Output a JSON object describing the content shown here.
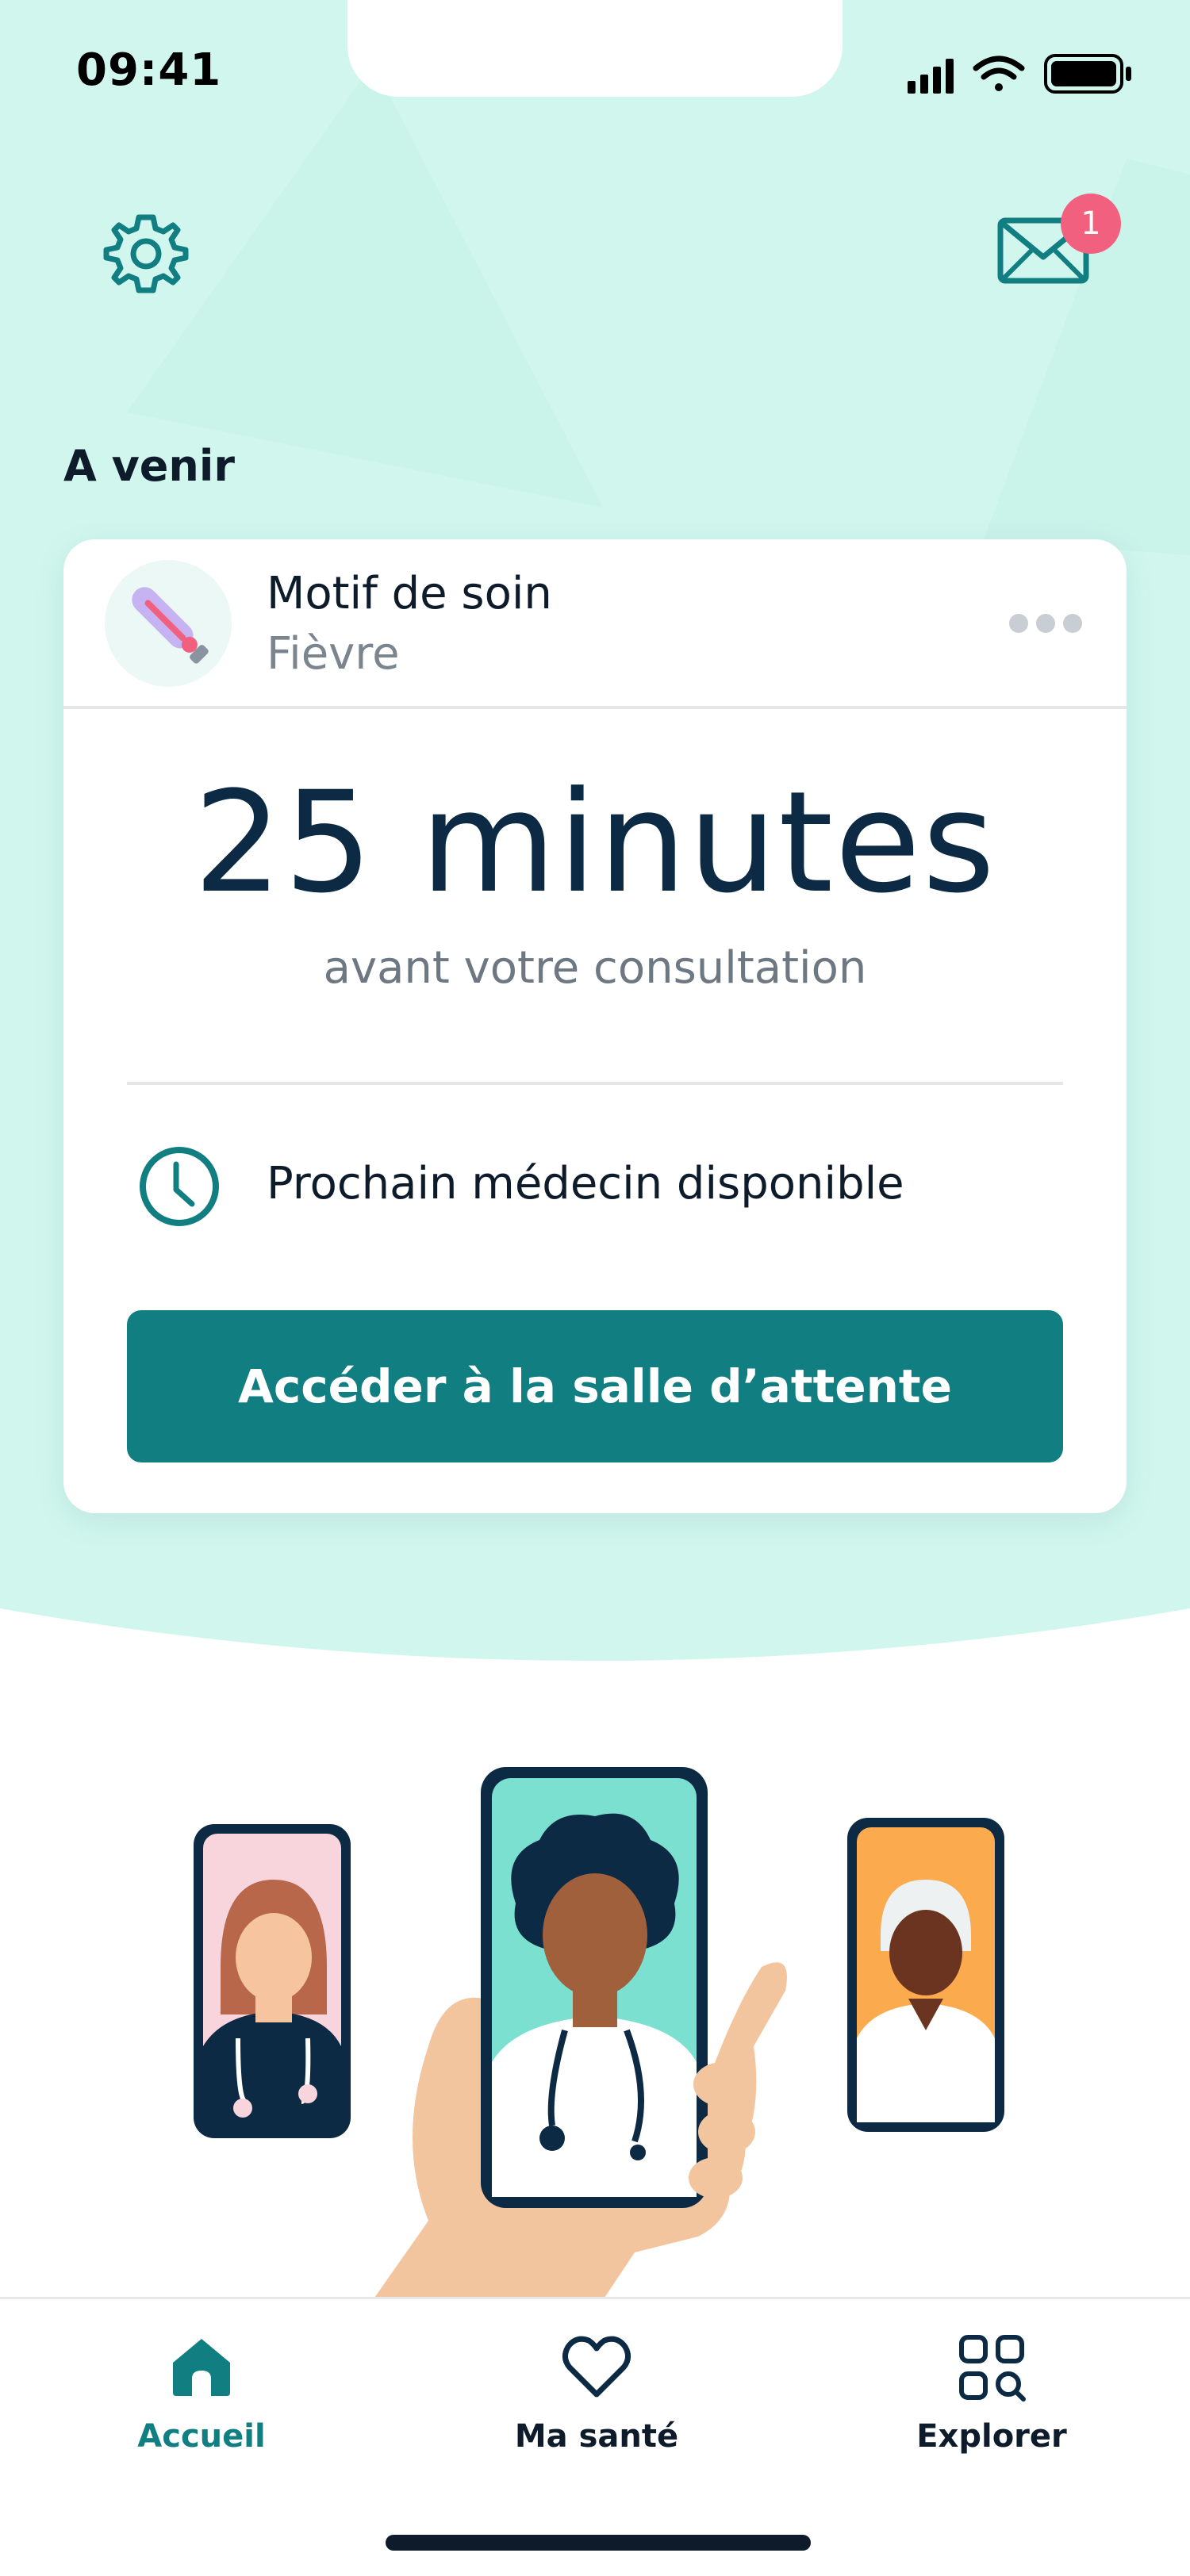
{
  "status_bar": {
    "time": "09:41",
    "icons": [
      "signal-icon",
      "wifi-icon",
      "battery-icon"
    ]
  },
  "header": {
    "settings_icon": "gear-icon",
    "mail_icon": "envelope-icon",
    "mail_badge_count": "1"
  },
  "section": {
    "title": "A venir"
  },
  "appointment_card": {
    "motif_label": "Motif de soin",
    "motif_value": "Fièvre",
    "motif_icon": "thermometer-icon",
    "more_icon": "more-dots-icon",
    "countdown": "25 minutes",
    "countdown_sub": "avant votre consultation",
    "doctor_icon": "clock-icon",
    "doctor_text": "Prochain médecin disponible",
    "cta_label": "Accéder à la salle d’attente"
  },
  "bottom_nav": {
    "items": [
      {
        "label": "Accueil",
        "icon": "home-icon",
        "active": true
      },
      {
        "label": "Ma santé",
        "icon": "heart-icon",
        "active": false
      },
      {
        "label": "Explorer",
        "icon": "grid-search-icon",
        "active": false
      }
    ]
  },
  "colors": {
    "mint_bg": "#d1f6ee",
    "primary": "#117e82",
    "navy": "#0d2a45",
    "badge": "#f2607f",
    "muted_text": "#7a8590"
  }
}
